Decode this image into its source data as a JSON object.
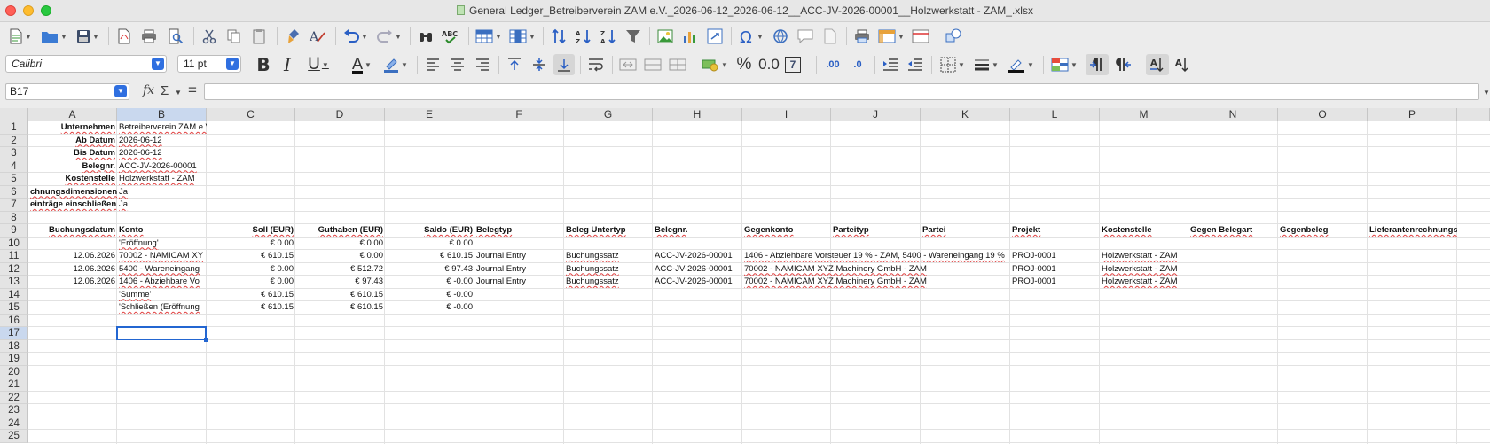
{
  "window": {
    "title": "General Ledger_Betreiberverein ZAM e.V._2026-06-12_2026-06-12__ACC-JV-2026-00001__Holzwerkstatt - ZAM_.xlsx"
  },
  "toolbar2": {
    "font_name": "Calibri",
    "font_size": "11 pt",
    "bold_glyph": "B",
    "italic_glyph": "I",
    "underline_glyph": "U",
    "font_color_glyph": "A",
    "percent_glyph": "%",
    "number_glyph": "0.0",
    "add_decimal_glyph": ".00",
    "del_decimal_glyph": ".0",
    "format_7_glyph": "7"
  },
  "formula": {
    "name_box": "B17",
    "fx_glyph": "fx",
    "sum_glyph": "Σ",
    "equals_glyph": "=",
    "value": ""
  },
  "columns": [
    "A",
    "B",
    "C",
    "D",
    "E",
    "F",
    "G",
    "H",
    "I",
    "J",
    "K",
    "L",
    "M",
    "N",
    "O",
    "P"
  ],
  "rows": [
    "1",
    "2",
    "3",
    "4",
    "5",
    "6",
    "7",
    "8",
    "9",
    "10",
    "11",
    "12",
    "13",
    "14",
    "15",
    "16",
    "17",
    "18",
    "19",
    "20",
    "21",
    "22",
    "23",
    "24",
    "25"
  ],
  "selected": {
    "column": "B",
    "row": "17"
  },
  "header_block": [
    {
      "label": "Unternehmen",
      "value": "Betreiberverein ZAM e.V."
    },
    {
      "label": "Ab Datum",
      "value": "2026-06-12"
    },
    {
      "label": "Bis Datum",
      "value": "2026-06-12"
    },
    {
      "label": "Belegnr.",
      "value": "ACC-JV-2026-00001"
    },
    {
      "label": "Kostenstelle",
      "value": "Holzwerkstatt - ZAM"
    },
    {
      "label": "chnungsdimensionen",
      "value": "Ja"
    },
    {
      "label": "einträge einschließen",
      "value": "Ja"
    }
  ],
  "table_headers": [
    "Buchungsdatum",
    "Konto",
    "Soll (EUR)",
    "Guthaben (EUR)",
    "Saldo (EUR)",
    "Belegtyp",
    "Beleg Untertyp",
    "Belegnr.",
    "Gegenkonto",
    "Parteityp",
    "Partei",
    "Projekt",
    "Kostenstelle",
    "Gegen Belegart",
    "Gegenbeleg",
    "Lieferantenrechnungsnr."
  ],
  "table_rows": [
    [
      "",
      "'Eröffnung'",
      "€ 0.00",
      "€ 0.00",
      "€ 0.00",
      "",
      "",
      "",
      "",
      "",
      "",
      "",
      "",
      "",
      "",
      ""
    ],
    [
      "12.06.2026",
      "70002 - NAMICAM XY",
      "€ 610.15",
      "€ 0.00",
      "€ 610.15",
      "Journal Entry",
      "Buchungssatz",
      "ACC-JV-2026-00001",
      "1406 - Abziehbare Vorsteuer 19 % - ZAM, 5400 - Wareneingang 19 %",
      "",
      "",
      "PROJ-0001",
      "Holzwerkstatt - ZAM",
      "",
      "",
      ""
    ],
    [
      "12.06.2026",
      "5400 - Wareneingang",
      "€ 0.00",
      "€ 512.72",
      "€ 97.43",
      "Journal Entry",
      "Buchungssatz",
      "ACC-JV-2026-00001",
      "70002 - NAMICAM XYZ Machinery GmbH - ZAM",
      "",
      "",
      "PROJ-0001",
      "Holzwerkstatt - ZAM",
      "",
      "",
      ""
    ],
    [
      "12.06.2026",
      "1406 - Abziehbare Vo",
      "€ 0.00",
      "€ 97.43",
      "€ -0.00",
      "Journal Entry",
      "Buchungssatz",
      "ACC-JV-2026-00001",
      "70002 - NAMICAM XYZ Machinery GmbH - ZAM",
      "",
      "",
      "PROJ-0001",
      "Holzwerkstatt - ZAM",
      "",
      "",
      ""
    ],
    [
      "",
      "'Summe'",
      "€ 610.15",
      "€ 610.15",
      "€ -0.00",
      "",
      "",
      "",
      "",
      "",
      "",
      "",
      "",
      "",
      "",
      ""
    ],
    [
      "",
      "'Schließen (Eröffnung",
      "€ 610.15",
      "€ 610.15",
      "€ -0.00",
      "",
      "",
      "",
      "",
      "",
      "",
      "",
      "",
      "",
      "",
      ""
    ]
  ]
}
